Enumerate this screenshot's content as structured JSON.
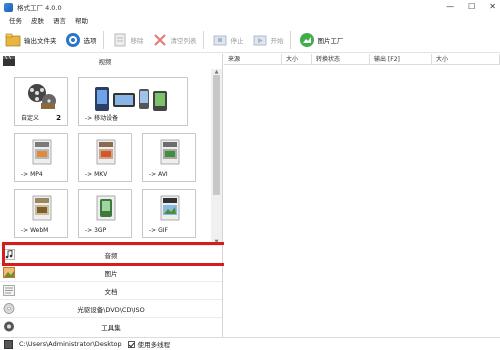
{
  "window": {
    "title": "格式工厂 4.0.0",
    "controls": [
      "—",
      "☐",
      "✕"
    ]
  },
  "menu": [
    "任务",
    "皮肤",
    "语言",
    "帮助"
  ],
  "toolbar": [
    {
      "label": "输出文件夹",
      "icon": "output-folder-icon",
      "disabled": false
    },
    {
      "label": "选项",
      "icon": "options-icon",
      "disabled": false
    },
    {
      "label": "移除",
      "icon": "remove-icon",
      "disabled": true
    },
    {
      "label": "清空列表",
      "icon": "clear-list-icon",
      "disabled": true
    },
    {
      "label": "停止",
      "icon": "stop-icon",
      "disabled": true
    },
    {
      "label": "开始",
      "icon": "start-icon",
      "disabled": true
    },
    {
      "label": "图片工厂",
      "icon": "picture-factory-icon",
      "disabled": false
    }
  ],
  "left": {
    "video_header": "视频",
    "tiles": [
      {
        "label": "自定义",
        "badge": "2",
        "icon": "film-reels-icon"
      },
      {
        "label": "-> 移动设备",
        "badge": "",
        "icon": "mobile-devices-icon"
      },
      {
        "label": "-> MP4",
        "badge": "",
        "icon": "mp4-file-icon"
      },
      {
        "label": "-> MKV",
        "badge": "",
        "icon": "mkv-file-icon"
      },
      {
        "label": "-> AVI",
        "badge": "",
        "icon": "avi-file-icon"
      },
      {
        "label": "-> WebM",
        "badge": "",
        "icon": "webm-file-icon"
      },
      {
        "label": "-> 3GP",
        "badge": "",
        "icon": "3gp-file-icon"
      },
      {
        "label": "-> GIF",
        "badge": "",
        "icon": "gif-file-icon"
      }
    ],
    "categories": [
      {
        "label": "音频",
        "icon": "music-note-icon"
      },
      {
        "label": "图片",
        "icon": "picture-icon"
      },
      {
        "label": "文档",
        "icon": "document-icon"
      },
      {
        "label": "光驱设备\\DVD\\CD\\ISO",
        "icon": "disc-drive-icon"
      },
      {
        "label": "工具集",
        "icon": "toolbox-icon"
      }
    ]
  },
  "right": {
    "columns": [
      "来源",
      "大小",
      "转换状态",
      "输出 [F2]",
      "大小"
    ]
  },
  "status": {
    "path": "C:\\Users\\Administrator\\Desktop",
    "checkbox_label": "使用多线程",
    "checked": true
  },
  "colors": {
    "highlight": "#d81c1c",
    "accent_blue": "#2a74c9"
  }
}
